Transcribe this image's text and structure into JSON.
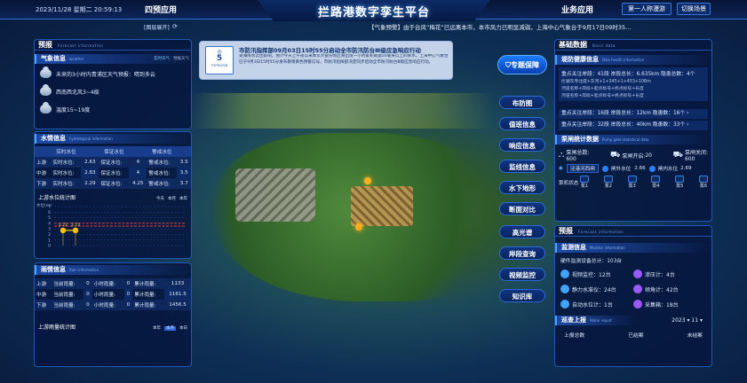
{
  "header": {
    "datetime": "2023/11/28 星期二  20:59:13",
    "tab_left": "四预应用",
    "title": "拦路港数字孪生平台",
    "tab_right": "业务应用",
    "user": "第一人称漫游",
    "switch": "切换场景"
  },
  "ticker": "【气象预警】由于台风“梅花”已远离本市，本市风力已明显减弱，上海中心气象台于9月17日09时35...",
  "layer_toggle": "[图层展开]",
  "alert": {
    "badge_num": "5",
    "badge_label": "TYPHOON",
    "text": "市防汛指挥部09月03日15时55分启动全市防汛防台Ⅲ级应急响应行动",
    "body": "受湖降水云团影响，预计今天上午夜以来本市大部分地区将出现一小时累积雨量50毫米以上的降水。上海中心气象台已于9月3日15时55分发布暴雨黄色预警信号。市防汛指挥部决定同步启动全市防汛防台Ⅲ级应急响应行动。"
  },
  "forecast": {
    "title": "预报",
    "sub": "Forecast information"
  },
  "weather": {
    "title": "气象信息",
    "sub": "weather",
    "tabs": [
      "实时天气",
      "预报天气"
    ],
    "items": [
      {
        "icon": "cloud-rain-icon",
        "text": "未来的3小时内青浦区天气预报：晴到多云"
      },
      {
        "icon": "cloud-icon",
        "text": "西南西北风3~4级"
      },
      {
        "icon": "cloud-sun-icon",
        "text": "温度15~19度"
      }
    ]
  },
  "water": {
    "title": "水情信息",
    "sub": "hydrological information",
    "headers": [
      "",
      "实时水位",
      "保证水位",
      "警戒水位"
    ],
    "rows": [
      {
        "name": "上游",
        "cells": [
          "实时水位:",
          "2.63",
          "保证水位:",
          "4",
          "警戒水位:",
          "3.5"
        ]
      },
      {
        "name": "中游",
        "cells": [
          "实时水位:",
          "2.83",
          "保证水位:",
          "4",
          "警戒水位:",
          "3.5"
        ]
      },
      {
        "name": "下游",
        "cells": [
          "实时水位:",
          "2.29",
          "保证水位:",
          "4.25",
          "警戒水位:",
          "3.7"
        ]
      }
    ],
    "chart_title": "上游水位统计图",
    "chart_tabs": [
      "今天",
      "本月",
      "本年"
    ],
    "y_label": "水位(m)"
  },
  "rain": {
    "title": "雨情信息",
    "sub": "Rain information",
    "rows": [
      {
        "name": "上游",
        "cells": [
          "当前雨量:",
          "0",
          "小时雨量:",
          "0",
          "累计雨量:",
          "1133"
        ]
      },
      {
        "name": "中游",
        "cells": [
          "当前雨量:",
          "0",
          "小时雨量:",
          "0",
          "累计雨量:",
          "1161.5"
        ]
      },
      {
        "name": "下游",
        "cells": [
          "当前雨量:",
          "0",
          "小时雨量:",
          "0",
          "累计雨量:",
          "1456.5"
        ]
      }
    ],
    "chart_title": "上游雨量统计图",
    "chart_tabs": [
      "本年",
      "本月",
      "本日"
    ]
  },
  "chart_data": [
    {
      "type": "line",
      "title": "上游水位统计图",
      "ylabel": "水位(m)",
      "ylim": [
        0,
        7
      ],
      "yticks": [
        0,
        1,
        2,
        3,
        4,
        5,
        6,
        7
      ],
      "series": [
        {
          "name": "",
          "values": [
            2.72,
            2.73
          ]
        }
      ],
      "data_labels": [
        "2.72",
        "2.73"
      ],
      "reference_lines": [
        {
          "name": "保证水位",
          "value": 4,
          "color": "#ff3b3b"
        },
        {
          "name": "警戒水位",
          "value": 3.5,
          "color": "#ff3b3b"
        }
      ],
      "grid": true
    }
  ],
  "side_buttons": [
    "布防图",
    "值班信息",
    "响应信息",
    "监线信息",
    "水下地形",
    "断面对比",
    "高光谱",
    "岸段查询",
    "视频监控",
    "知识库"
  ],
  "logo_text": "专题保障",
  "basic": {
    "title": "基础数据",
    "sub": "Basic data",
    "dyke": {
      "title": "堤防健康信息",
      "sub": "Dike health information",
      "items": [
        {
          "text": "重点关注岸段：41段 岸段总长：6.635km 隐患总数：4个"
        },
        {
          "text": "拦湖东寺北堤+东河+1+345+1+453+108m"
        },
        {
          "text": "河道名称+岸段+起点标号+终点标号+长度"
        },
        {
          "text": "河道名称+岸段+起点标号+终点标号+长度"
        }
      ],
      "extra": [
        {
          "text": "重点关注岸段：16段 岸段总长：12km 隐患数：16个"
        },
        {
          "text": "重点关注岸段：32段 岸段总长：40km 隐患数：33个"
        }
      ]
    }
  },
  "gate": {
    "title": "泵闸统计数据",
    "sub": "Pump gate statistical data",
    "total_label": "泵闸总数:",
    "total": "600",
    "open_label": "泵闸开启:",
    "open": "20",
    "closed_label": "泵闸关闭:",
    "closed": "600",
    "station": "泾港河西闸",
    "in_label": "闸外水位",
    "in_val": "2.66",
    "out_label": "闸内水位",
    "out_val": "2.69",
    "pumps_label": "泵机状态",
    "pumps": [
      "泵1",
      "泵2",
      "泵3",
      "泵4",
      "泵5",
      "泵6"
    ]
  },
  "forecast_r": {
    "title": "预报",
    "sub": "Forecast information",
    "monitor": "监测信息",
    "monitor_sub": "Monitor information",
    "count_label": "硬件监测设备总计：",
    "count": "103台",
    "items": [
      {
        "icon": "video-icon",
        "label": "视频监控：",
        "val": "12台",
        "color": "#3fa3ff"
      },
      {
        "icon": "seepage-icon",
        "label": "渗压计：",
        "val": "4台",
        "color": "#9b59ff"
      },
      {
        "icon": "level-icon",
        "label": "静力水准仪：",
        "val": "24台",
        "color": "#3fa3ff"
      },
      {
        "icon": "inclino-icon",
        "label": "倾角计：",
        "val": "42台",
        "color": "#9b59ff"
      },
      {
        "icon": "water-level-icon",
        "label": "自动水位计：",
        "val": "1台",
        "color": "#3fa3ff"
      },
      {
        "icon": "collector-icon",
        "label": "采集箱：",
        "val": "18台",
        "color": "#9b59ff"
      }
    ]
  },
  "patrol": {
    "title": "巡查上报",
    "sub": "Patrol report",
    "year": "2023",
    "month": "11",
    "cols": [
      "上报总数",
      "已结案",
      "未结案"
    ]
  }
}
